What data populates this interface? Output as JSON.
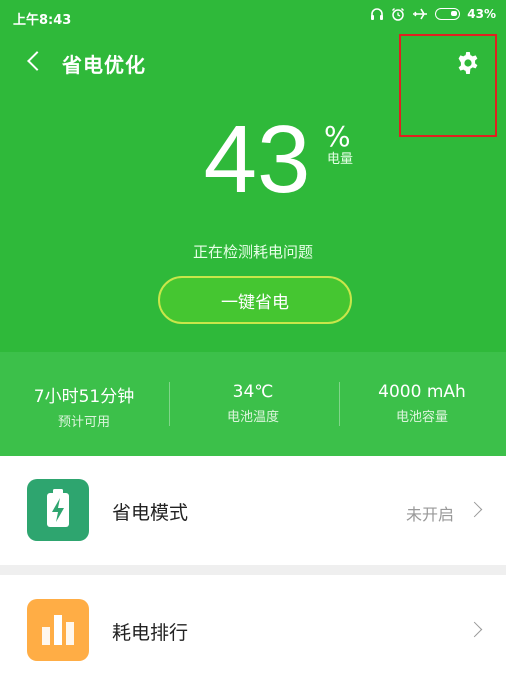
{
  "status_bar": {
    "time": "上午8:43",
    "battery_percent": "43%"
  },
  "header": {
    "title": "省电优化"
  },
  "battery": {
    "level": "43",
    "percent_sign": "%",
    "level_label": "电量",
    "checking_text": "正在检测耗电问题",
    "optimize_button": "一键省电"
  },
  "stats": [
    {
      "value": "7小时51分钟",
      "label": "预计可用"
    },
    {
      "value": "34℃",
      "label": "电池温度"
    },
    {
      "value": "4000 mAh",
      "label": "电池容量"
    }
  ],
  "list": [
    {
      "title": "省电模式",
      "status": "未开启",
      "icon": "battery-saver-icon",
      "color": "#2ea56f"
    },
    {
      "title": "耗电排行",
      "status": "",
      "icon": "usage-ranking-icon",
      "color": "#ffad45"
    }
  ],
  "colors": {
    "primary_green": "#2fb93a",
    "stats_green": "#3cc04a",
    "highlight": "#e02020"
  }
}
